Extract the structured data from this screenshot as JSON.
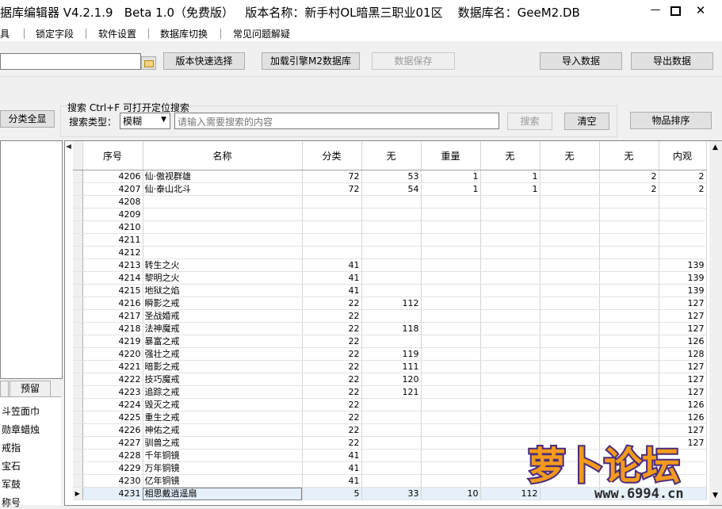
{
  "window": {
    "title": "据库编辑器 V4.2.1.9   Beta 1.0（免费版）   版本名称：新手村OL暗黑三职业01区    数据库名：GeeM2.DB",
    "minimize": "—",
    "close": "✕"
  },
  "menu": [
    "具",
    "锁定字段",
    "软件设置",
    "数据库切换",
    "常见问题解疑"
  ],
  "toolbar": {
    "version_quick_select": "版本快速选择",
    "load_engine_db": "加载引擎M2数据库",
    "save_data": "数据保存",
    "import_data": "导入数据",
    "export_data": "导出数据"
  },
  "search": {
    "show_all_categories": "分类全显",
    "group_label": "搜索  Ctrl+F 可打开定位搜索",
    "type_label": "搜索类型：",
    "type_value": "模糊",
    "placeholder": "请输入需要搜索的内容",
    "search_button": "搜索",
    "clear_button": "清空",
    "sort_button": "物品排序"
  },
  "left": {
    "tab": "预留",
    "items": [
      "斗笠面巾",
      "勋章蜡烛",
      "戒指",
      "宝石",
      "军鼓",
      "称号"
    ]
  },
  "grid": {
    "columns": [
      "序号",
      "名称",
      "分类",
      "无",
      "重量",
      "无",
      "无",
      "无",
      "内观"
    ],
    "rows": [
      [
        "4206",
        "仙·傲视群雄",
        "72",
        "53",
        "1",
        "1",
        "",
        "2",
        "2"
      ],
      [
        "4207",
        "仙·泰山北斗",
        "72",
        "54",
        "1",
        "1",
        "",
        "2",
        "2"
      ],
      [
        "4208",
        "",
        "",
        "",
        "",
        "",
        "",
        "",
        ""
      ],
      [
        "4209",
        "",
        "",
        "",
        "",
        "",
        "",
        "",
        ""
      ],
      [
        "4210",
        "",
        "",
        "",
        "",
        "",
        "",
        "",
        ""
      ],
      [
        "4211",
        "",
        "",
        "",
        "",
        "",
        "",
        "",
        ""
      ],
      [
        "4212",
        "",
        "",
        "",
        "",
        "",
        "",
        "",
        ""
      ],
      [
        "4213",
        "转生之火",
        "41",
        "",
        "",
        "",
        "",
        "",
        "139"
      ],
      [
        "4214",
        "黎明之火",
        "41",
        "",
        "",
        "",
        "",
        "",
        "139"
      ],
      [
        "4215",
        "地狱之焰",
        "41",
        "",
        "",
        "",
        "",
        "",
        "139"
      ],
      [
        "4216",
        "瞬影之戒",
        "22",
        "112",
        "",
        "",
        "",
        "",
        "127"
      ],
      [
        "4217",
        "圣战婚戒",
        "22",
        "",
        "",
        "",
        "",
        "",
        "127"
      ],
      [
        "4218",
        "法神魔戒",
        "22",
        "118",
        "",
        "",
        "",
        "",
        "127"
      ],
      [
        "4219",
        "暴富之戒",
        "22",
        "",
        "",
        "",
        "",
        "",
        "126"
      ],
      [
        "4220",
        "强壮之戒",
        "22",
        "119",
        "",
        "",
        "",
        "",
        "128"
      ],
      [
        "4221",
        "暗影之戒",
        "22",
        "111",
        "",
        "",
        "",
        "",
        "127"
      ],
      [
        "4222",
        "技巧魔戒",
        "22",
        "120",
        "",
        "",
        "",
        "",
        "127"
      ],
      [
        "4223",
        "追踪之戒",
        "22",
        "121",
        "",
        "",
        "",
        "",
        "127"
      ],
      [
        "4224",
        "毁灭之戒",
        "22",
        "",
        "",
        "",
        "",
        "",
        "126"
      ],
      [
        "4225",
        "重生之戒",
        "22",
        "",
        "",
        "",
        "",
        "",
        "126"
      ],
      [
        "4226",
        "神佑之戒",
        "22",
        "",
        "",
        "",
        "",
        "",
        "127"
      ],
      [
        "4227",
        "驯兽之戒",
        "22",
        "",
        "",
        "",
        "",
        "",
        "127"
      ],
      [
        "4228",
        "千年铜镜",
        "41",
        "",
        "",
        "",
        "",
        "",
        ""
      ],
      [
        "4229",
        "万年铜镜",
        "41",
        "",
        "",
        "",
        "",
        "",
        ""
      ],
      [
        "4230",
        "亿年铜镜",
        "41",
        "",
        "",
        "",
        "",
        "",
        ""
      ],
      [
        "4231",
        "相思戴逍遥扇",
        "5",
        "33",
        "10",
        "112",
        "",
        "",
        ""
      ]
    ],
    "selected_row": 25
  },
  "watermark": {
    "logo_text": "萝卜论坛",
    "url": "www.6994.cn"
  },
  "colors": {
    "selected_row": "#e5f0fb",
    "logo_orange": "#f39a1c",
    "logo_purple": "#4a2c7c"
  }
}
